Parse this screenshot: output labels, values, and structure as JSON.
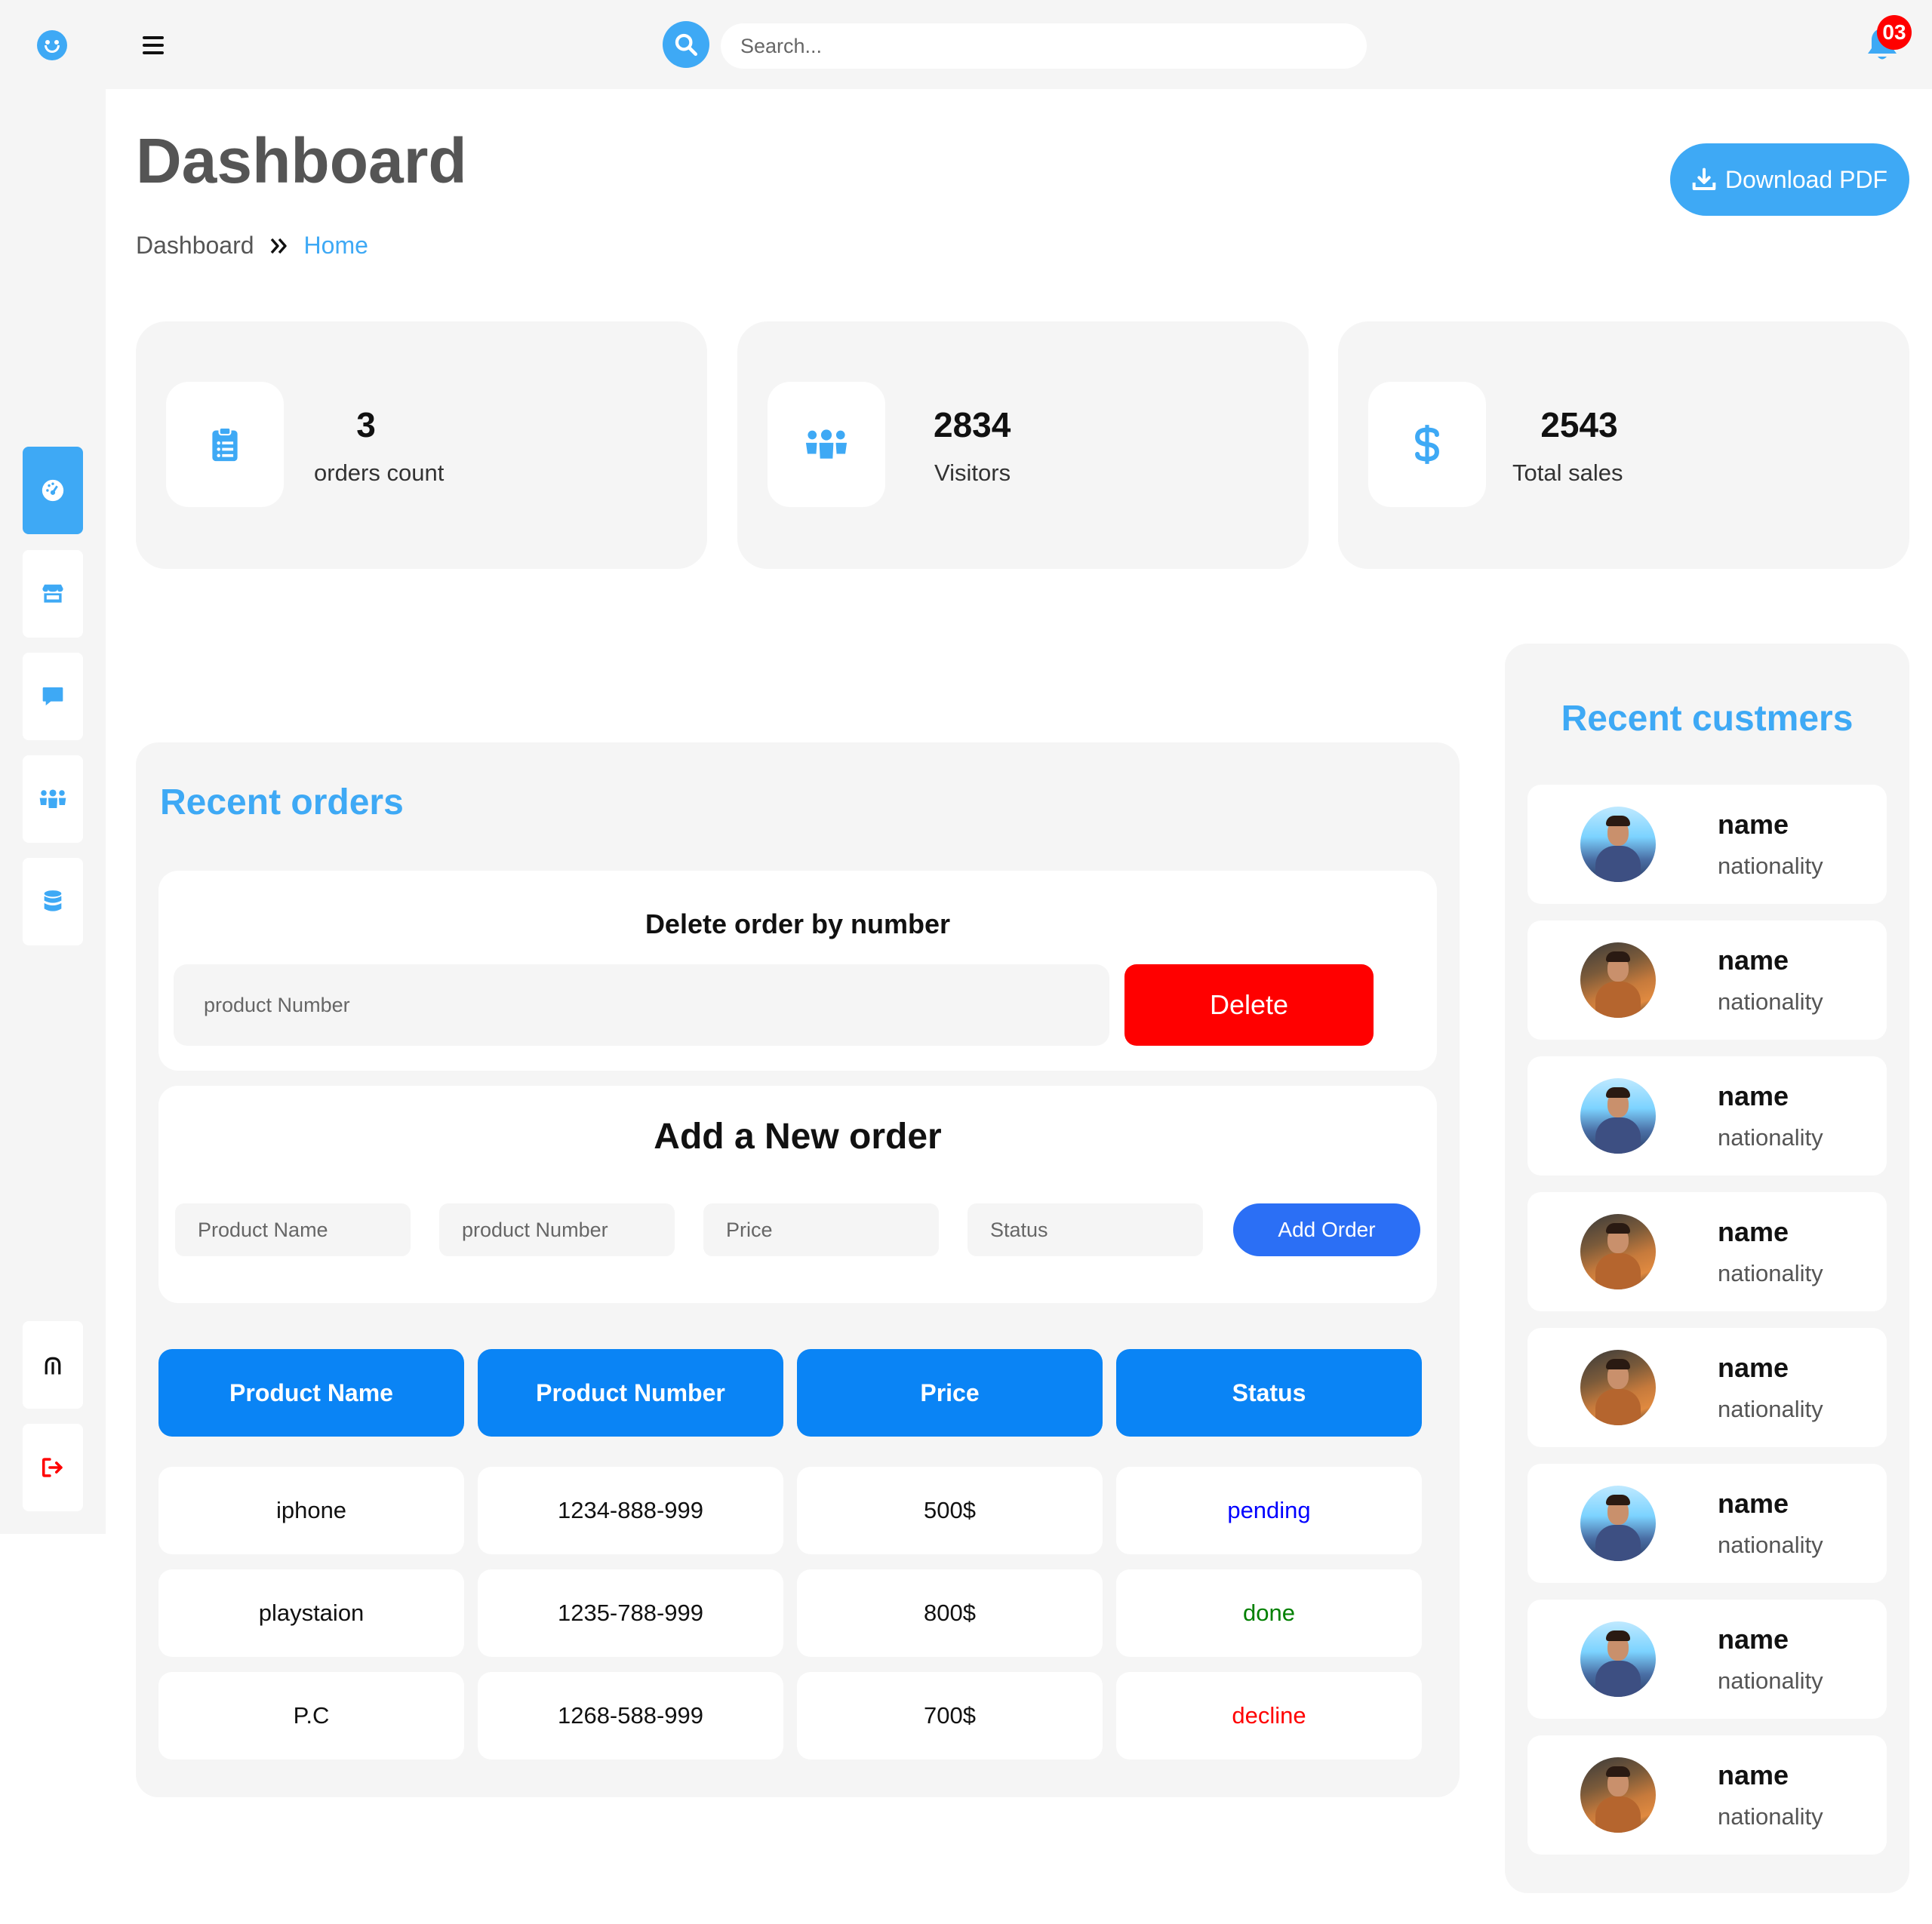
{
  "header": {
    "search_placeholder": "Search...",
    "notification_count": "03"
  },
  "page": {
    "title": "Dashboard",
    "breadcrumb": {
      "root": "Dashboard",
      "current": "Home"
    },
    "download_label": "Download PDF"
  },
  "stats": [
    {
      "value": "3",
      "label": "orders count",
      "icon": "clipboard-list-icon"
    },
    {
      "value": "2834",
      "label": "Visitors",
      "icon": "users-icon"
    },
    {
      "value": "2543",
      "label": "Total sales",
      "icon": "dollar-icon"
    }
  ],
  "sidebar": {
    "items": [
      {
        "name": "dashboard",
        "icon": "gauge-icon",
        "active": true
      },
      {
        "name": "store",
        "icon": "store-icon",
        "active": false
      },
      {
        "name": "messages",
        "icon": "comment-icon",
        "active": false
      },
      {
        "name": "users",
        "icon": "users-icon",
        "active": false
      },
      {
        "name": "database",
        "icon": "database-icon",
        "active": false
      }
    ],
    "bottom": [
      {
        "name": "analytics",
        "icon": "signal-icon"
      },
      {
        "name": "logout",
        "icon": "logout-icon"
      }
    ]
  },
  "orders": {
    "title": "Recent orders",
    "delete_form": {
      "title": "Delete order by number",
      "placeholder": "product Number",
      "button": "Delete"
    },
    "add_form": {
      "title": "Add a New order",
      "placeholders": [
        "Product Name",
        "product Number",
        "Price",
        "Status"
      ],
      "button": "Add Order"
    },
    "columns": [
      "Product Name",
      "Product Number",
      "Price",
      "Status"
    ],
    "rows": [
      {
        "name": "iphone",
        "number": "1234-888-999",
        "price": "500$",
        "status": "pending",
        "status_color": "#0000ff"
      },
      {
        "name": "playstaion",
        "number": "1235-788-999",
        "price": "800$",
        "status": "done",
        "status_color": "#008000"
      },
      {
        "name": "P.C",
        "number": "1268-588-999",
        "price": "700$",
        "status": "decline",
        "status_color": "#ff0000"
      }
    ]
  },
  "customers": {
    "title": "Recent custmers",
    "items": [
      {
        "name": "name",
        "nationality": "nationality",
        "avatar": "blue"
      },
      {
        "name": "name",
        "nationality": "nationality",
        "avatar": "orange"
      },
      {
        "name": "name",
        "nationality": "nationality",
        "avatar": "blue"
      },
      {
        "name": "name",
        "nationality": "nationality",
        "avatar": "orange"
      },
      {
        "name": "name",
        "nationality": "nationality",
        "avatar": "orange"
      },
      {
        "name": "name",
        "nationality": "nationality",
        "avatar": "blue"
      },
      {
        "name": "name",
        "nationality": "nationality",
        "avatar": "blue"
      },
      {
        "name": "name",
        "nationality": "nationality",
        "avatar": "orange"
      }
    ]
  },
  "colors": {
    "accent": "#3ea9f5",
    "table_header": "#0a84f5",
    "delete": "#ff0000",
    "add": "#2b6ff5"
  }
}
